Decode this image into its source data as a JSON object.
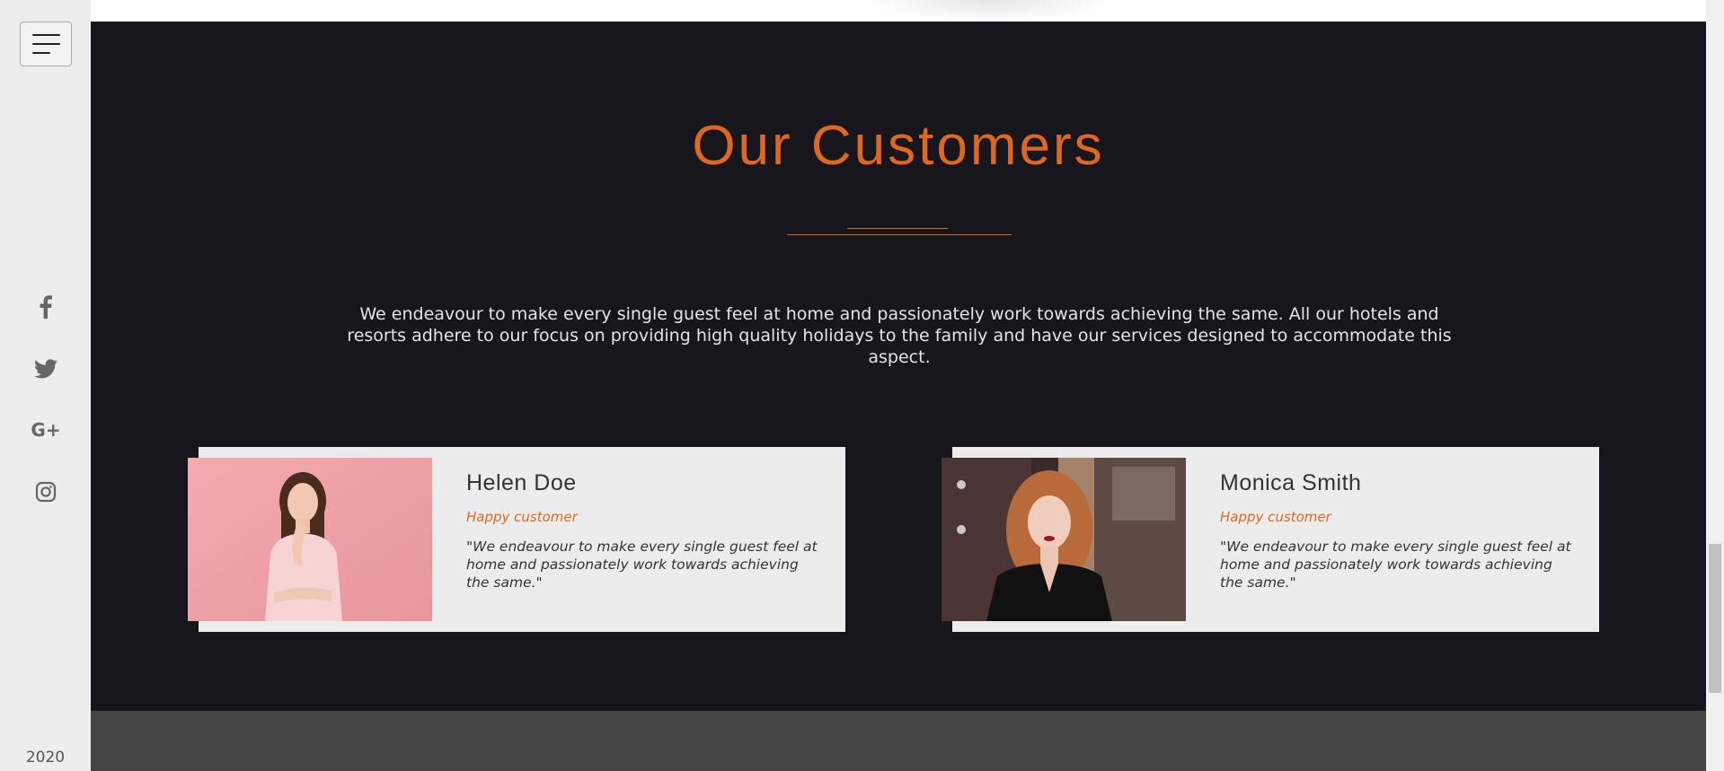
{
  "sidebar": {
    "menu_icon": "hamburger-menu-icon",
    "social": [
      {
        "name": "facebook",
        "icon": "facebook-icon"
      },
      {
        "name": "twitter",
        "icon": "twitter-icon"
      },
      {
        "name": "google-plus",
        "icon": "google-plus-icon",
        "label": "G+"
      },
      {
        "name": "instagram",
        "icon": "instagram-icon"
      }
    ],
    "year": "2020"
  },
  "customers_section": {
    "title": "Our Customers",
    "intro": "We endeavour to make every single guest feel at home and passionately work towards achieving the same. All our hotels and resorts adhere to our focus on providing high quality holidays to the family and have our services designed to accommodate this aspect.",
    "testimonials": [
      {
        "name": "Helen Doe",
        "role": "Happy customer",
        "quote": "\"We endeavour to make every single guest feel at home and passionately work towards achieving the same.\""
      },
      {
        "name": "Monica Smith",
        "role": "Happy customer",
        "quote": "\"We endeavour to make every single guest feel at home and passionately work towards achieving the same.\""
      }
    ]
  },
  "colors": {
    "accent": "#e0681e",
    "section_bg": "#17161c",
    "sidebar_bg": "#ededed",
    "card_bg": "#ececec",
    "footer_bg": "#454545"
  }
}
